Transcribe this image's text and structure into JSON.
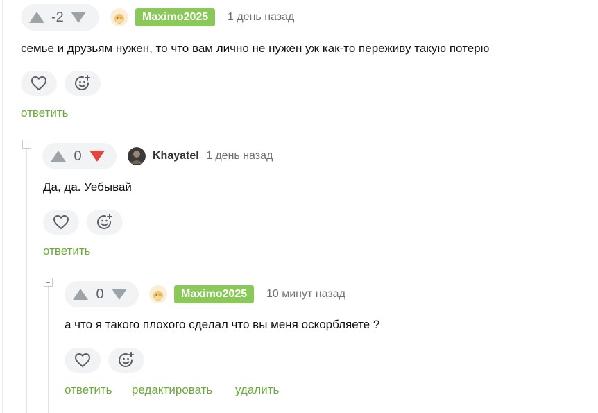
{
  "comments": [
    {
      "rating": "-2",
      "author": "Maximo2025",
      "time": "1 день назад",
      "text": "семье и друзьям нужен, то что вам лично не нужен уж как-то переживу такую потерю",
      "actions": {
        "reply": "ответить"
      }
    },
    {
      "rating": "0",
      "author": "Khayatel",
      "time": "1 день назад",
      "text": "Да, да. Уебывай",
      "actions": {
        "reply": "ответить"
      }
    },
    {
      "rating": "0",
      "author": "Maximo2025",
      "time": "10 минут назад",
      "text": "а что я такого плохого сделал что вы меня оскорбляете ?",
      "actions": {
        "reply": "ответить",
        "edit": "редактировать",
        "delete": "удалить"
      }
    }
  ],
  "colors": {
    "accent_green": "#6aab3a",
    "badge_green": "#8ac858",
    "downvote_active": "#e2463f"
  },
  "icons": [
    "upvote-icon",
    "downvote-icon",
    "heart-icon",
    "emoji-add-icon",
    "collapse-icon",
    "avatar"
  ]
}
